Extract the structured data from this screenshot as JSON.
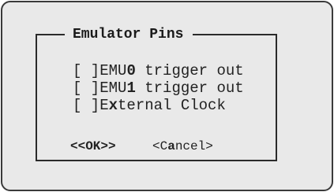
{
  "dialog": {
    "title": "Emulator Pins",
    "options": [
      {
        "checkbox": "[ ]",
        "pre": "EMU",
        "hotkey": "0",
        "post": " trigger out",
        "checked": false
      },
      {
        "checkbox": "[ ]",
        "pre": "EMU",
        "hotkey": "1",
        "post": " trigger out",
        "checked": false
      },
      {
        "checkbox": "[ ]",
        "pre": "E",
        "hotkey": "x",
        "post": "ternal Clock",
        "checked": false
      }
    ],
    "ok_button": {
      "open": "<<",
      "label": "OK",
      "close": ">>"
    },
    "cancel_button": {
      "open": "<",
      "pre": "C",
      "hotkey": "a",
      "post": "ncel",
      "close": ">"
    }
  }
}
